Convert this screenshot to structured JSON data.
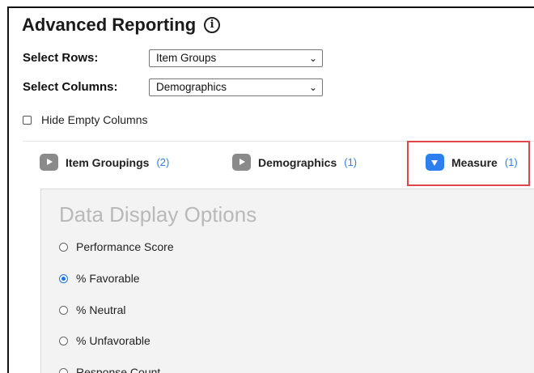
{
  "header": {
    "title": "Advanced Reporting",
    "info_icon": "info-icon"
  },
  "rows_select": {
    "label": "Select Rows:",
    "value": "Item Groups"
  },
  "columns_select": {
    "label": "Select Columns:",
    "value": "Demographics"
  },
  "hide_empty": {
    "label": "Hide Empty Columns",
    "checked": false
  },
  "tabs": [
    {
      "label": "Item Groupings",
      "count": "(2)",
      "icon": "play-icon",
      "expanded": false
    },
    {
      "label": "Demographics",
      "count": "(1)",
      "icon": "play-icon",
      "expanded": false
    },
    {
      "label": "Measure",
      "count": "(1)",
      "icon": "chevron-down-icon",
      "expanded": true
    }
  ],
  "panel": {
    "title": "Data Display Options",
    "options": [
      {
        "label": "Performance Score",
        "selected": false
      },
      {
        "label": "% Favorable",
        "selected": true
      },
      {
        "label": "% Neutral",
        "selected": false
      },
      {
        "label": "% Unfavorable",
        "selected": false
      },
      {
        "label": "Response Count",
        "selected": false
      }
    ]
  },
  "colors": {
    "accent": "#2d7ff0",
    "highlight": "#e0464c",
    "panel_bg": "#f3f3f3",
    "muted_title": "#b9b9b9"
  }
}
